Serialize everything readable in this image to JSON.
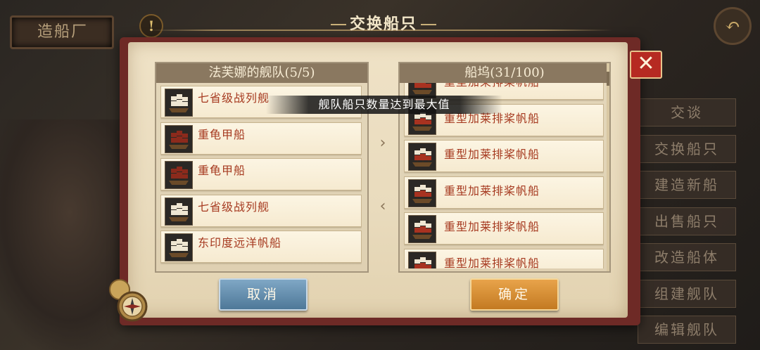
{
  "background": {
    "shipyard_sign": "造船厂",
    "alert_badge": "!",
    "side_menu": [
      "交谈",
      "交换船只",
      "建造新船",
      "出售船只",
      "改造船体",
      "组建舰队",
      "编辑舰队"
    ]
  },
  "dialog": {
    "title": "交换船只",
    "close_symbol": "✕",
    "toast": "舰队船只数量达到最大值",
    "left_column": {
      "header": "法芙娜的舰队(5/5)",
      "ships": [
        {
          "name": "七省级战列舰",
          "icon": "galleon-white-sails-icon"
        },
        {
          "name": "重龟甲船",
          "icon": "turtle-ship-red-sails-icon"
        },
        {
          "name": "重龟甲船",
          "icon": "turtle-ship-red-sails-icon"
        },
        {
          "name": "七省级战列舰",
          "icon": "galleon-white-sails-icon"
        },
        {
          "name": "东印度远洋帆船",
          "icon": "galleon-white-sails-icon"
        }
      ]
    },
    "right_column": {
      "header": "船坞(31/100)",
      "ships": [
        {
          "name": "重型加莱排桨帆船",
          "icon": "galleass-red-white-sails-icon"
        },
        {
          "name": "重型加莱排桨帆船",
          "icon": "galleass-red-white-sails-icon"
        },
        {
          "name": "重型加莱排桨帆船",
          "icon": "galleass-red-white-sails-icon"
        },
        {
          "name": "重型加莱排桨帆船",
          "icon": "galleass-red-white-sails-icon"
        },
        {
          "name": "重型加莱排桨帆船",
          "icon": "galleass-red-white-sails-icon"
        },
        {
          "name": "重型加莱排桨帆船",
          "icon": "galleass-red-white-sails-icon"
        }
      ]
    },
    "arrow_right": "›",
    "arrow_left": "‹",
    "cancel_label": "取消",
    "confirm_label": "确定"
  },
  "colors": {
    "frame_red": "#6e2a26",
    "parchment": "#efe2c6",
    "ship_name": "#a63a20",
    "cancel_blue": "#4e7898",
    "confirm_orange": "#c37a22"
  }
}
